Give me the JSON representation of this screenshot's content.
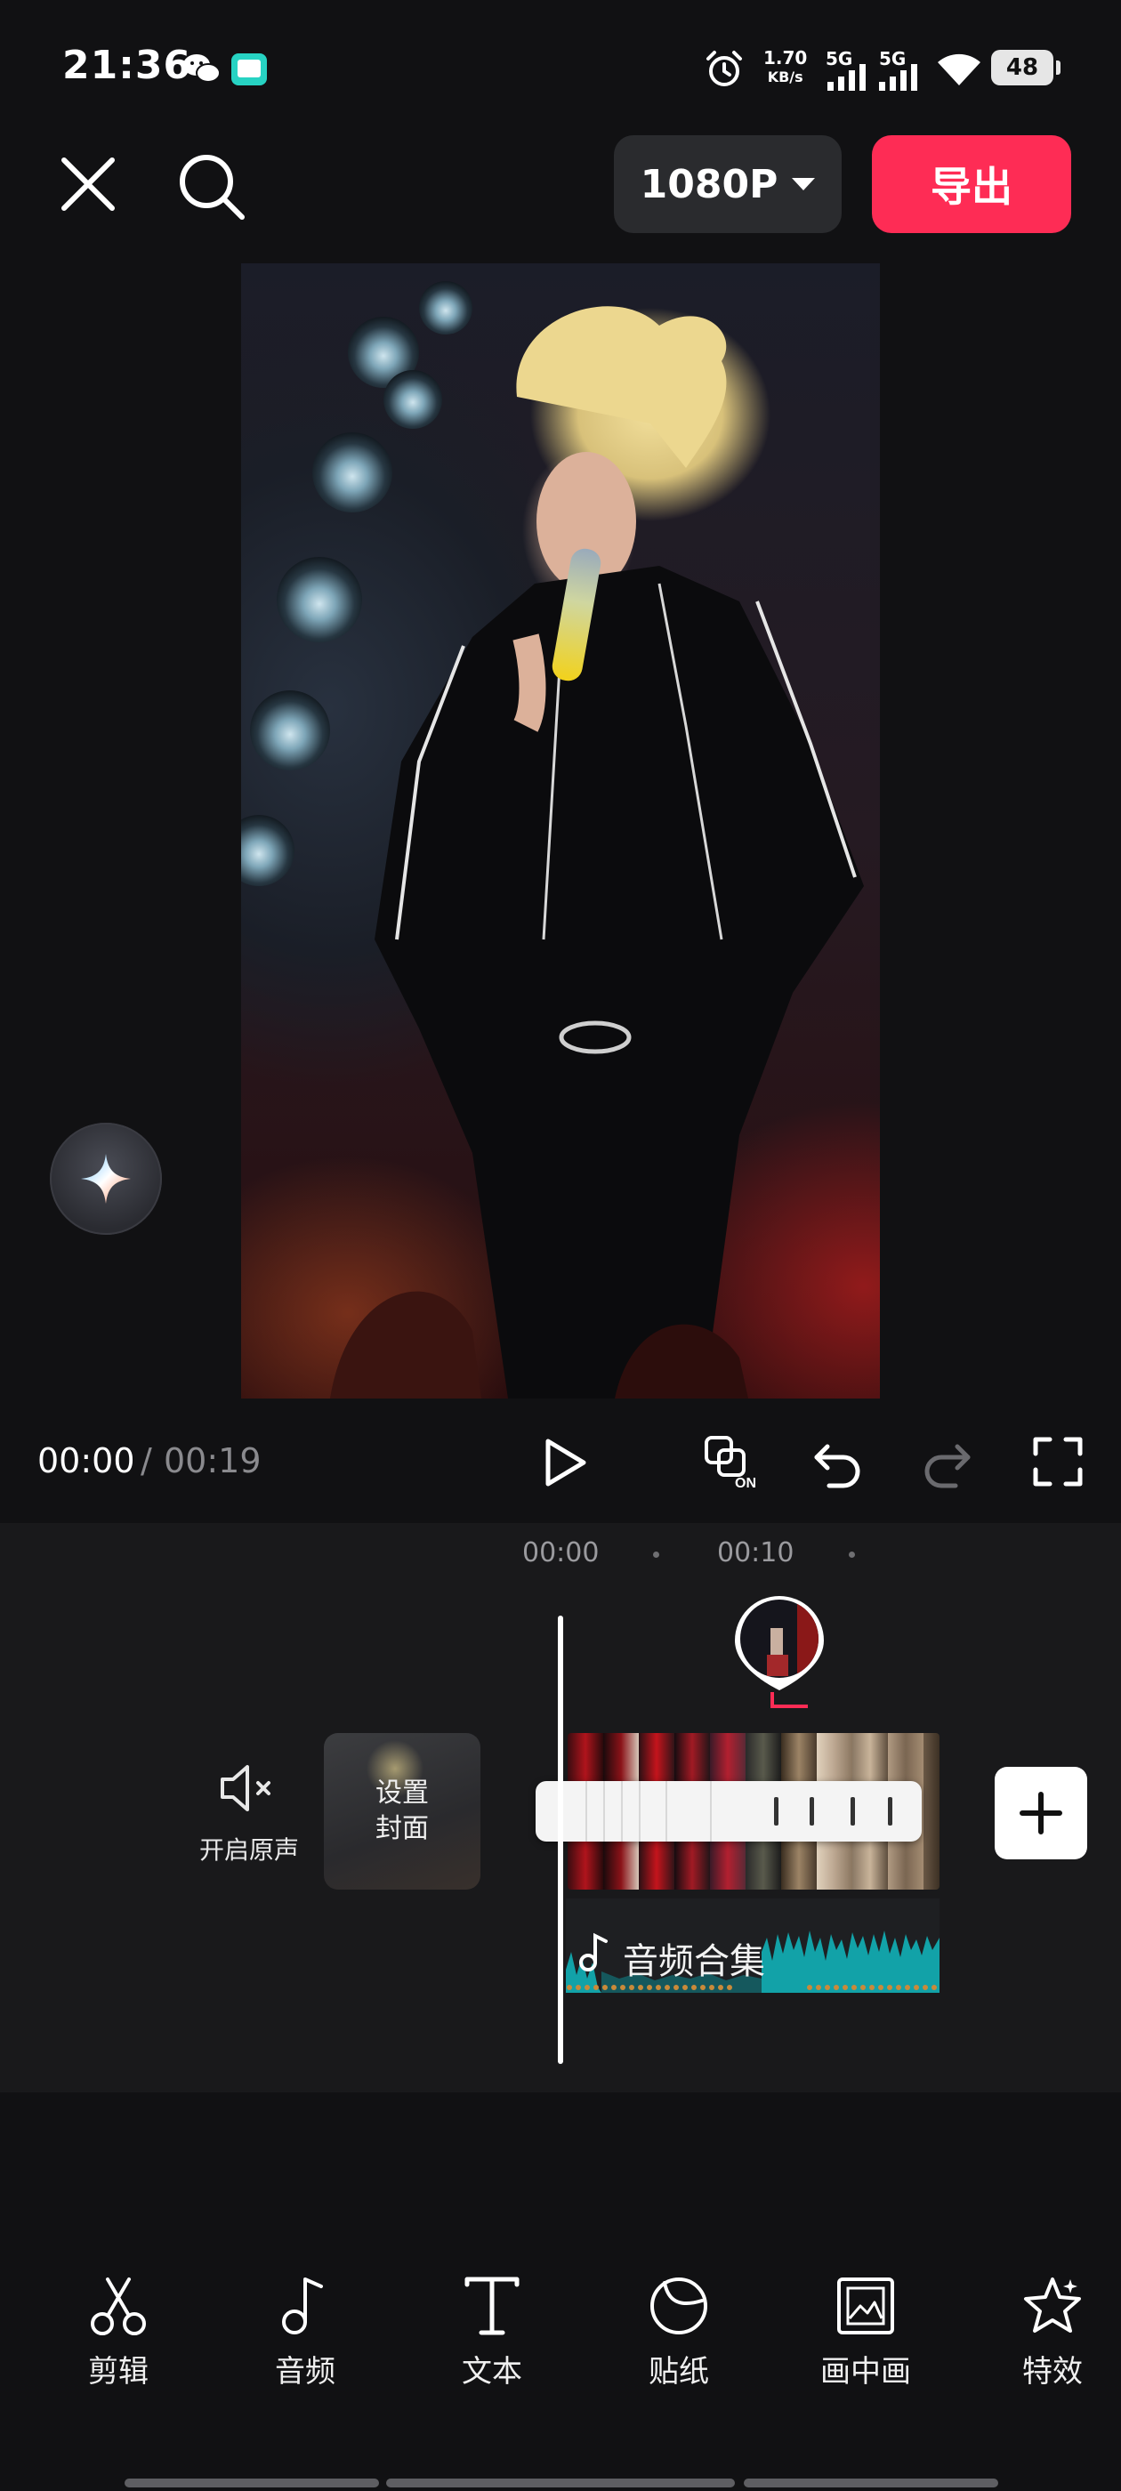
{
  "status_bar": {
    "time": "21:36",
    "net_speed_value": "1.70",
    "net_speed_unit": "KB/s",
    "signal_1": "5G",
    "signal_2": "5G",
    "battery": "48"
  },
  "top_bar": {
    "resolution": "1080P",
    "export_label": "导出"
  },
  "playback": {
    "current_time": "00:00",
    "separator": "/",
    "total_time": "00:19"
  },
  "timeline": {
    "ruler": [
      "00:00",
      "00:10"
    ],
    "mute_label": "开启原声",
    "cover_label_line1": "设置",
    "cover_label_line2": "封面",
    "audio_label": "音频合集"
  },
  "toolbar": {
    "items": [
      {
        "label": "剪辑",
        "icon": "scissors-icon"
      },
      {
        "label": "音频",
        "icon": "music-note-icon"
      },
      {
        "label": "文本",
        "icon": "text-icon"
      },
      {
        "label": "贴纸",
        "icon": "sticker-icon"
      },
      {
        "label": "画中画",
        "icon": "picture-in-picture-icon"
      },
      {
        "label": "特效",
        "icon": "effects-star-icon"
      }
    ]
  },
  "colors": {
    "accent": "#fe2c55",
    "background": "#111113",
    "audio_wave": "#12a2a8"
  }
}
